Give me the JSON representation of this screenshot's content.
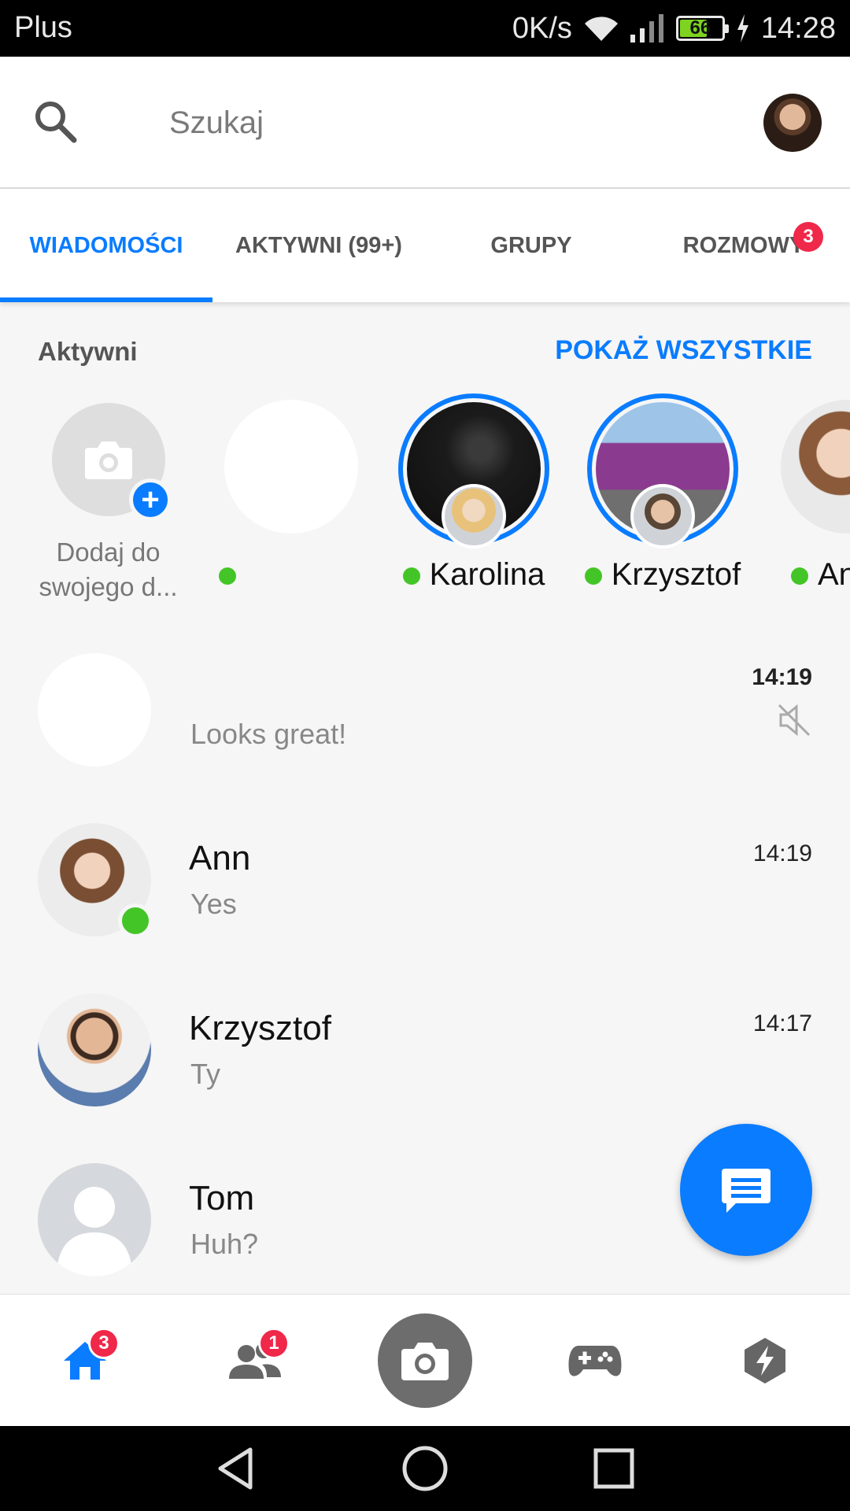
{
  "status_bar": {
    "carrier": "Plus",
    "net_speed": "0K/s",
    "battery": "66",
    "battery_level": 0.66,
    "time": "14:28"
  },
  "search": {
    "placeholder": "Szukaj"
  },
  "tabs": [
    {
      "label": "WIADOMOŚCI",
      "active": true
    },
    {
      "label": "AKTYWNI (99+)",
      "active": false
    },
    {
      "label": "GRUPY",
      "active": false
    },
    {
      "label": "ROZMOWY",
      "active": false,
      "badge": "3"
    }
  ],
  "active_section": {
    "title": "Aktywni",
    "show_all": "POKAŻ WSZYSTKIE",
    "add_story_label": "Dodaj do swojego d...",
    "stories": [
      {
        "name": "",
        "online": true,
        "ring": false
      },
      {
        "name": "Karolina",
        "online": true,
        "ring": true
      },
      {
        "name": "Krzysztof",
        "online": true,
        "ring": true
      },
      {
        "name": "An",
        "online": true,
        "ring": false
      }
    ]
  },
  "conversations": [
    {
      "name": "",
      "message": "Looks great!",
      "time": "14:19",
      "muted": true,
      "unread": true
    },
    {
      "name": "Ann",
      "message": "Yes",
      "time": "14:19",
      "online": true
    },
    {
      "name": "Krzysztof",
      "message": "Ty",
      "time": "14:17"
    },
    {
      "name": "Tom",
      "message": "Huh?",
      "time": ""
    }
  ],
  "bottom_nav": {
    "home_badge": "3",
    "people_badge": "1"
  },
  "colors": {
    "accent": "#0a7cff",
    "online": "#44c527",
    "badge": "#f02849"
  }
}
